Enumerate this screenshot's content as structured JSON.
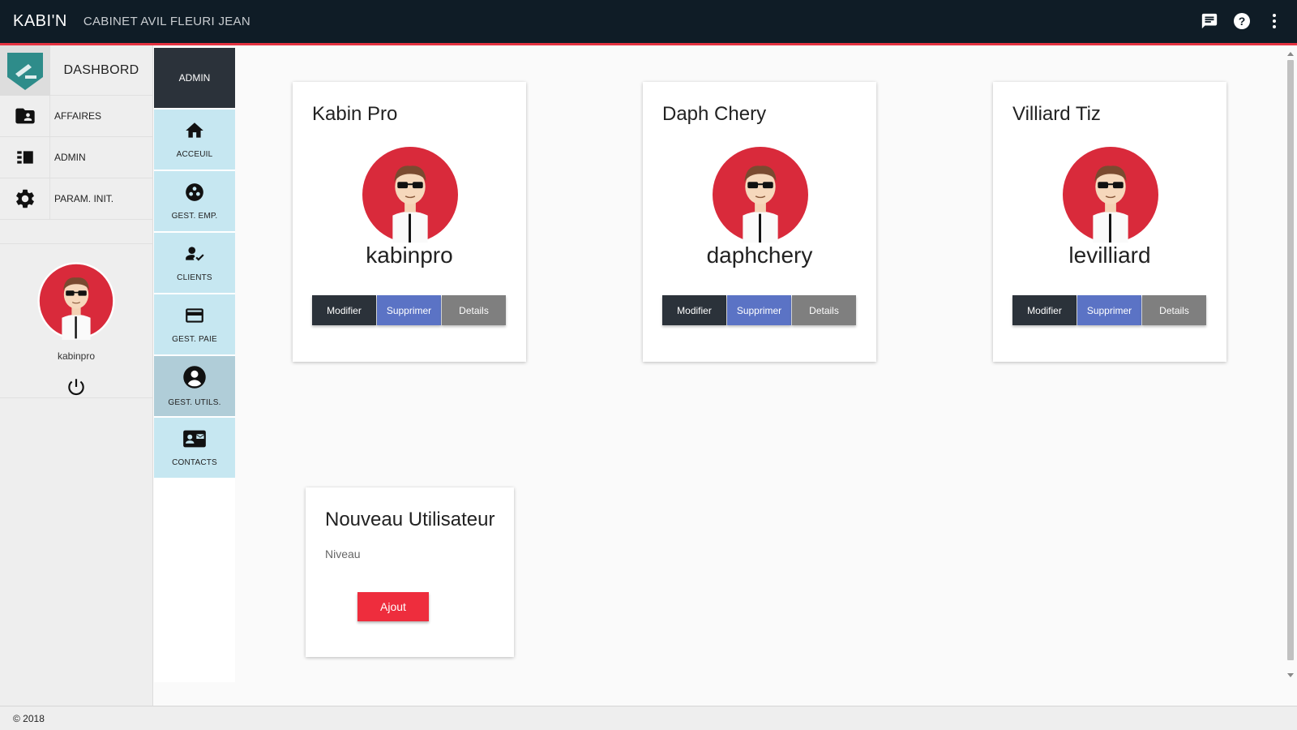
{
  "header": {
    "brand": "KABI'N",
    "subtitle": "CABINET AVIL FLEURI JEAN",
    "icons": [
      "message-icon",
      "help-icon",
      "more-vert-icon"
    ]
  },
  "sidebar": {
    "dashboard_label": "DASHBORD",
    "logo_text": "KABI'N",
    "items": [
      {
        "label": "AFFAIRES",
        "icon": "folder-shared-icon"
      },
      {
        "label": "ADMIN",
        "icon": "view-list-icon"
      },
      {
        "label": "PARAM. INIT.",
        "icon": "settings-icon"
      }
    ],
    "profile_name": "kabinpro"
  },
  "admin_menu": {
    "header": "ADMIN",
    "items": [
      {
        "label": "ACCEUIL",
        "icon": "home-icon"
      },
      {
        "label": "GEST. EMP.",
        "icon": "group-work-icon"
      },
      {
        "label": "CLIENTS",
        "icon": "person-check-icon"
      },
      {
        "label": "GEST. PAIE",
        "icon": "credit-card-icon"
      },
      {
        "label": "GEST. UTILS.",
        "icon": "account-circle-icon",
        "active": true
      },
      {
        "label": "CONTACTS",
        "icon": "contact-mail-icon"
      }
    ]
  },
  "users": [
    {
      "name": "Kabin Pro",
      "username": "kabinpro"
    },
    {
      "name": "Daph Chery",
      "username": "daphchery"
    },
    {
      "name": "Villiard Tiz",
      "username": "levilliard"
    }
  ],
  "user_actions": {
    "modify": "Modifier",
    "delete": "Supprimer",
    "details": "Details"
  },
  "new_user": {
    "title": "Nouveau Utilisateur",
    "level_label": "Niveau",
    "add_button": "Ajout"
  },
  "footer": {
    "copyright": "© 2018"
  },
  "colors": {
    "topbar": "#0f1c26",
    "accent": "#e53341",
    "avatar_bg": "#d92a3b",
    "admin_menu_bg": "#c6e7f1",
    "modify": "#2b323a",
    "delete": "#5b73c5",
    "details": "#7f7f7f"
  }
}
